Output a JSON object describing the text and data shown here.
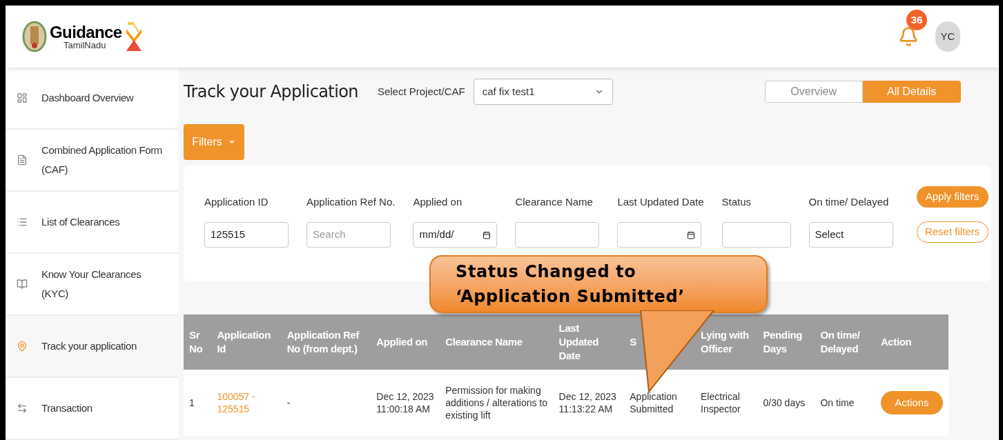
{
  "header": {
    "logo": {
      "name": "Guidance",
      "sub": "TamilNadu"
    },
    "notifications": {
      "count": "36"
    },
    "avatar": "YC"
  },
  "sidebar": {
    "items": [
      {
        "label": "Dashboard Overview",
        "selected": false
      },
      {
        "label": "Combined Application Form (CAF)",
        "selected": false
      },
      {
        "label": "List of Clearances",
        "selected": false
      },
      {
        "label": "Know Your Clearances (KYC)",
        "selected": false
      },
      {
        "label": "Track your application",
        "selected": true
      },
      {
        "label": "Transaction",
        "selected": false
      }
    ]
  },
  "page": {
    "title": "Track your Application",
    "project_label": "Select Project/CAF",
    "project_value": "caf fix test1",
    "view_tabs": [
      {
        "label": "Overview",
        "selected": false
      },
      {
        "label": "All Details",
        "selected": true
      }
    ],
    "filters_button": "Filters",
    "filters": [
      {
        "label": "Application ID",
        "value": "125515"
      },
      {
        "label": "Application Ref No.",
        "placeholder": "Search"
      },
      {
        "label": "Applied on",
        "value": "mm/dd/",
        "kind": "date"
      },
      {
        "label": "Clearance Name"
      },
      {
        "label": "Last Updated Date",
        "kind": "date"
      },
      {
        "label": "Status"
      },
      {
        "label": "On time/ Delayed",
        "value": "Select"
      }
    ],
    "apply_button": "Apply filters",
    "reset_button": "Reset filters"
  },
  "table": {
    "columns": [
      "Sr No",
      "Application Id",
      "Application Ref No (from dept.)",
      "Applied on",
      "Clearance Name",
      "Last Updated Date",
      "S",
      "Lying with Officer",
      "Pending Days",
      "On time/ Delayed",
      "Action"
    ],
    "rows": [
      {
        "cells": [
          "1",
          "100057 - 125515",
          "-",
          "Dec 12, 2023 11:00:18 AM",
          "Permission for making additions / alterations to existing lift",
          "Dec 12, 2023 11:13:22 AM",
          "Application Submitted",
          "Electrical Inspector",
          "0/30 days",
          "On time"
        ],
        "action": "Actions"
      }
    ]
  },
  "callout": "Status Changed to ‘Application Submitted’"
}
